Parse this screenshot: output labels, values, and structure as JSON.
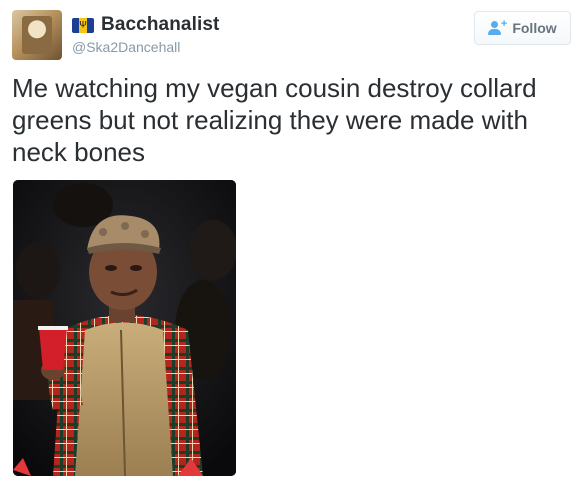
{
  "tweet": {
    "author": {
      "display_name": "Bacchanalist",
      "handle": "@Ska2Dancehall",
      "flag_icon": "barbados-flag-icon",
      "avatar": "user-avatar"
    },
    "follow_button": {
      "label": "Follow",
      "icon": "add-user-icon"
    },
    "text": "Me watching my vegan cousin destroy collard greens but not realizing they were made with neck bones",
    "media": {
      "type": "animated-gif-image",
      "description_icon": "tweet-media-image"
    }
  },
  "colors": {
    "text": "#292f33",
    "secondary_text": "#8899a6",
    "follow_icon": "#55acee",
    "button_text": "#66757f",
    "button_border": "#e1e8ed"
  }
}
